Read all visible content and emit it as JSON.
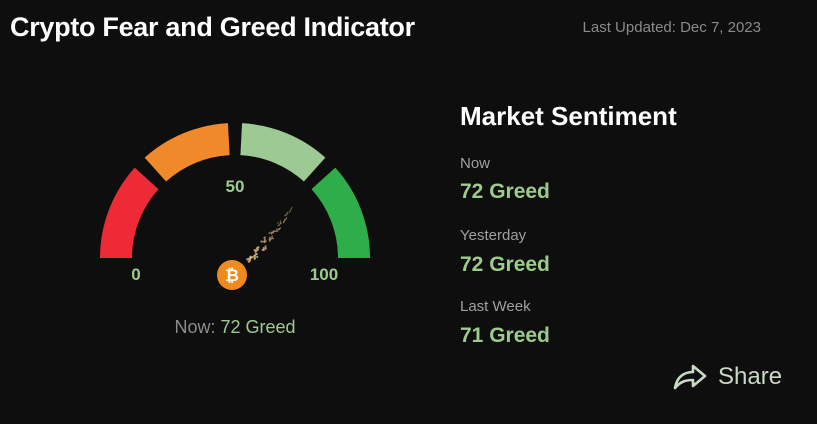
{
  "header": {
    "title": "Crypto Fear and Greed Indicator",
    "last_updated": "Last Updated: Dec 7, 2023"
  },
  "gauge": {
    "value": 72,
    "min_label": "0",
    "mid_label": "50",
    "max_label": "100",
    "center_icon": "bitcoin-icon",
    "colors": {
      "fear_extreme": "#ee2a36",
      "fear": "#f0892a",
      "greed": "#9dc993",
      "greed_extreme": "#2ead4b",
      "bitcoin": "#f08a1c"
    },
    "now_label": "Now:",
    "now_value": "72 Greed"
  },
  "sentiment": {
    "title": "Market Sentiment",
    "items": [
      {
        "label": "Now",
        "value": "72 Greed"
      },
      {
        "label": "Yesterday",
        "value": "72 Greed"
      },
      {
        "label": "Last Week",
        "value": "71 Greed"
      }
    ]
  },
  "share": {
    "label": "Share",
    "icon": "share-arrow-icon"
  }
}
